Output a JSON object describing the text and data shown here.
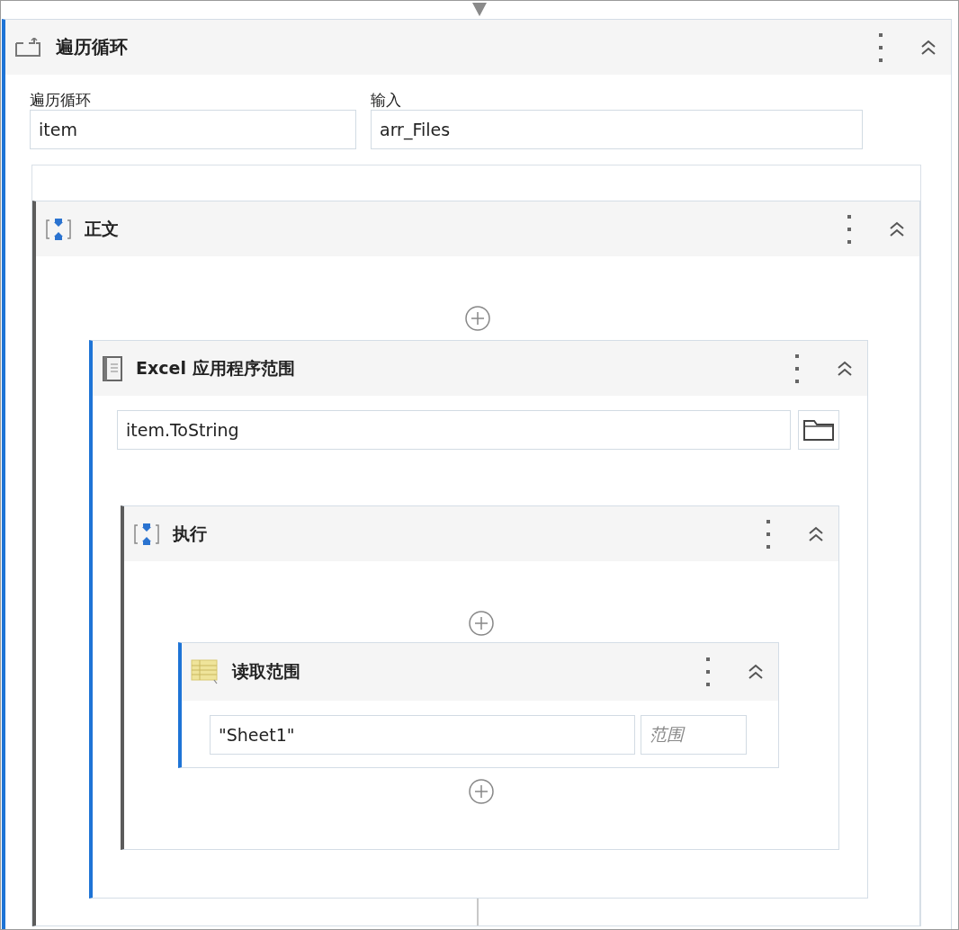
{
  "activity": {
    "kind": "loop",
    "title": "遍历循环",
    "inputs": [
      {
        "label": "遍历循环",
        "value": "item"
      },
      {
        "label": "输入",
        "value": "arr_Files"
      }
    ],
    "children": [
      {
        "kind": "sequence",
        "title": "正文",
        "end": {
          "kind": "connector"
        },
        "children": [
          {
            "kind": "excel",
            "title": "Excel 应用程序范围",
            "inputs": [
              {
                "value": "item.ToString"
              }
            ],
            "children": [
              {
                "kind": "sequence",
                "title": "执行",
                "end": {
                  "kind": "add"
                },
                "children": [
                  {
                    "kind": "read_range",
                    "title": "读取范围",
                    "inputs": [
                      {
                        "value": "\"Sheet1\""
                      },
                      {
                        "placeholder": "范围"
                      }
                    ]
                  }
                ]
              }
            ]
          }
        ]
      }
    ]
  }
}
